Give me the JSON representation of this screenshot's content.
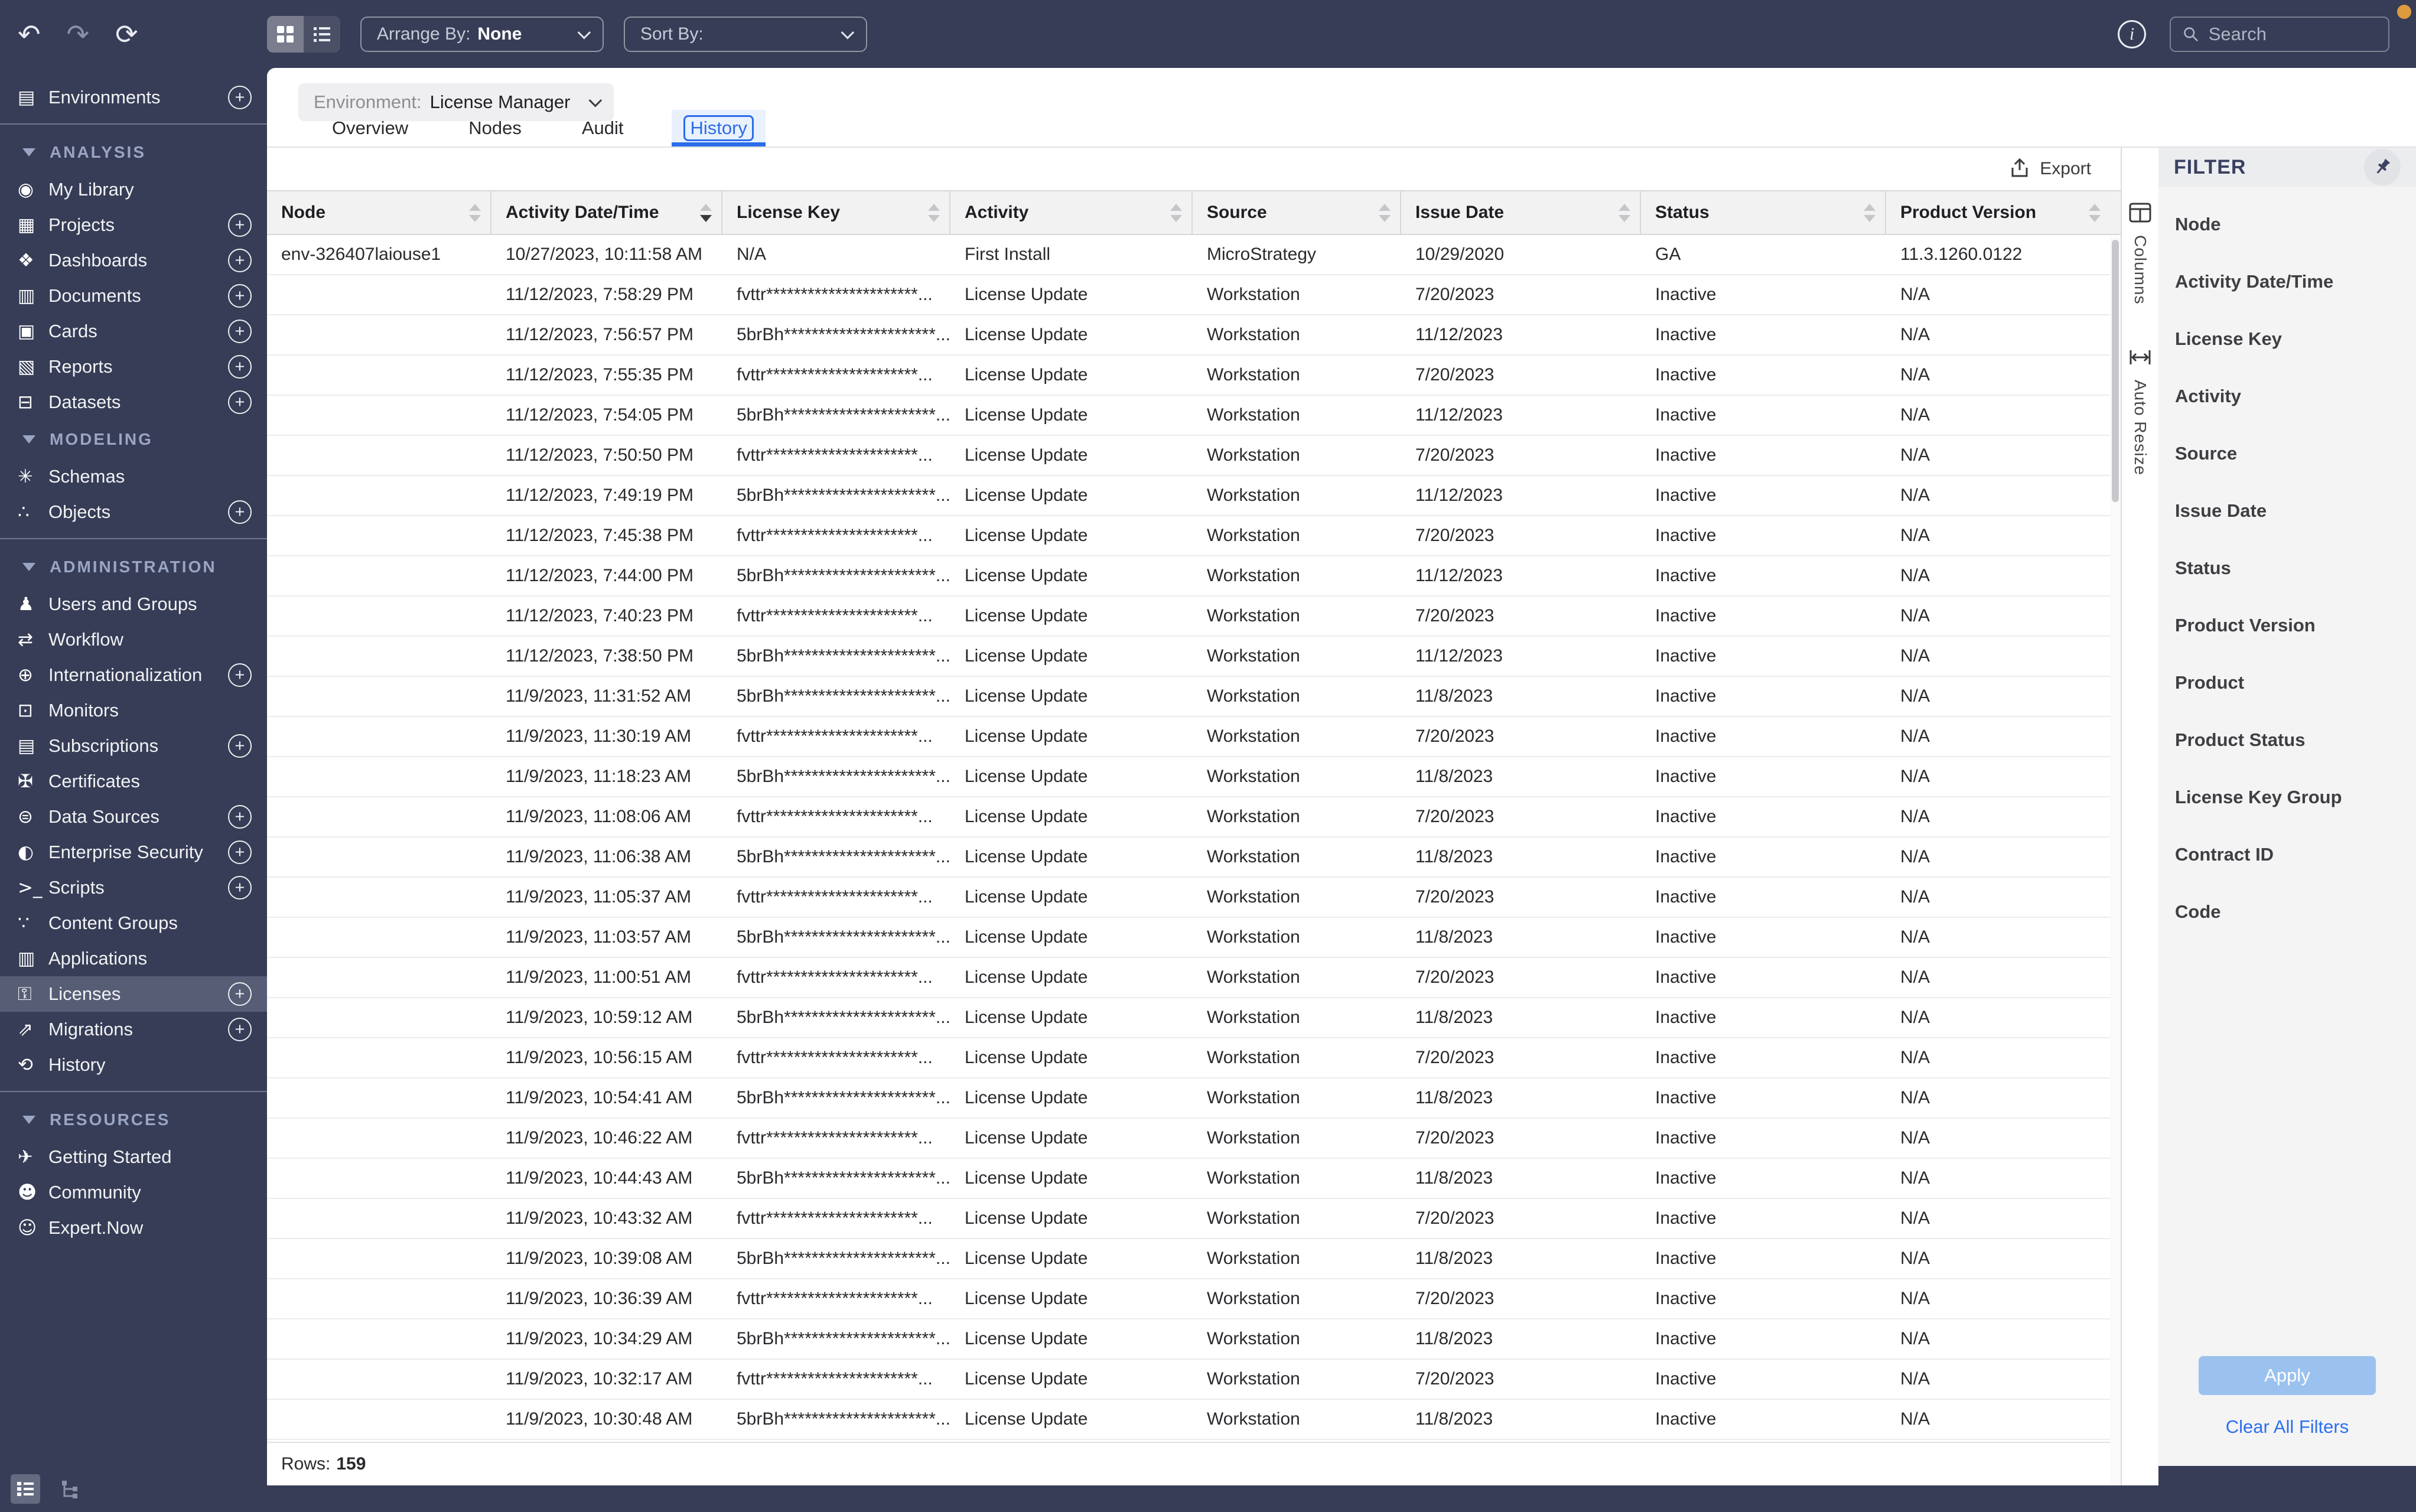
{
  "colors": {
    "topbar_navy": "#373D56",
    "accent_blue": "#2B6CEA",
    "apply_button": "#9BC2EE",
    "clear_link": "#2C6FEF",
    "notification_dot": "#DD9A3F",
    "sidebar_selected": "#575D75"
  },
  "topbar": {
    "arrange_by_label": "Arrange By:",
    "arrange_by_value": "None",
    "sort_by_label": "Sort By:",
    "search_placeholder": "Search"
  },
  "sidebar": {
    "items": [
      {
        "type": "item",
        "label": "Environments",
        "icon": "environments",
        "plus": true
      },
      {
        "type": "divider"
      },
      {
        "type": "section",
        "label": "ANALYSIS"
      },
      {
        "type": "item",
        "label": "My Library",
        "icon": "my-library"
      },
      {
        "type": "item",
        "label": "Projects",
        "icon": "projects",
        "plus": true
      },
      {
        "type": "item",
        "label": "Dashboards",
        "icon": "dashboards",
        "plus": true
      },
      {
        "type": "item",
        "label": "Documents",
        "icon": "documents",
        "plus": true
      },
      {
        "type": "item",
        "label": "Cards",
        "icon": "cards",
        "plus": true
      },
      {
        "type": "item",
        "label": "Reports",
        "icon": "reports",
        "plus": true
      },
      {
        "type": "item",
        "label": "Datasets",
        "icon": "datasets",
        "plus": true
      },
      {
        "type": "section",
        "label": "MODELING"
      },
      {
        "type": "item",
        "label": "Schemas",
        "icon": "schemas"
      },
      {
        "type": "item",
        "label": "Objects",
        "icon": "objects",
        "plus": true
      },
      {
        "type": "divider"
      },
      {
        "type": "section",
        "label": "ADMINISTRATION"
      },
      {
        "type": "item",
        "label": "Users and Groups",
        "icon": "users-and-groups"
      },
      {
        "type": "item",
        "label": "Workflow",
        "icon": "workflow"
      },
      {
        "type": "item",
        "label": "Internationalization",
        "icon": "internationalization",
        "plus": true
      },
      {
        "type": "item",
        "label": "Monitors",
        "icon": "monitors"
      },
      {
        "type": "item",
        "label": "Subscriptions",
        "icon": "subscriptions",
        "plus": true
      },
      {
        "type": "item",
        "label": "Certificates",
        "icon": "certificates"
      },
      {
        "type": "item",
        "label": "Data Sources",
        "icon": "data-sources",
        "plus": true
      },
      {
        "type": "item",
        "label": "Enterprise Security",
        "icon": "enterprise-security",
        "plus": true
      },
      {
        "type": "item",
        "label": "Scripts",
        "icon": "scripts",
        "plus": true
      },
      {
        "type": "item",
        "label": "Content Groups",
        "icon": "content-groups"
      },
      {
        "type": "item",
        "label": "Applications",
        "icon": "applications"
      },
      {
        "type": "item",
        "label": "Licenses",
        "icon": "licenses",
        "plus": true,
        "selected": true
      },
      {
        "type": "item",
        "label": "Migrations",
        "icon": "migrations",
        "plus": true
      },
      {
        "type": "item",
        "label": "History",
        "icon": "history"
      },
      {
        "type": "divider"
      },
      {
        "type": "section",
        "label": "RESOURCES"
      },
      {
        "type": "item",
        "label": "Getting Started",
        "icon": "getting-started"
      },
      {
        "type": "item",
        "label": "Community",
        "icon": "community"
      },
      {
        "type": "item",
        "label": "Expert.Now",
        "icon": "expert-now"
      }
    ]
  },
  "env": {
    "label": "Environment:",
    "value": "License Manager"
  },
  "tabs": [
    {
      "label": "Overview"
    },
    {
      "label": "Nodes"
    },
    {
      "label": "Audit"
    },
    {
      "label": "History",
      "active": true
    }
  ],
  "toolbar": {
    "export_label": "Export"
  },
  "table": {
    "columns": [
      {
        "label": "Node",
        "sort": "none"
      },
      {
        "label": "Activity Date/Time",
        "sort": "desc"
      },
      {
        "label": "License Key",
        "sort": "none"
      },
      {
        "label": "Activity",
        "sort": "none"
      },
      {
        "label": "Source",
        "sort": "none"
      },
      {
        "label": "Issue Date",
        "sort": "none"
      },
      {
        "label": "Status",
        "sort": "none"
      },
      {
        "label": "Product Version",
        "sort": "none"
      }
    ],
    "rows": [
      [
        "env-326407laiouse1",
        "10/27/2023, 10:11:58 AM",
        "N/A",
        "First Install",
        "MicroStrategy",
        "10/29/2020",
        "GA",
        "11.3.1260.0122"
      ],
      [
        "",
        "11/12/2023, 7:58:29 PM",
        "fvttr**********************...",
        "License Update",
        "Workstation",
        "7/20/2023",
        "Inactive",
        "N/A"
      ],
      [
        "",
        "11/12/2023, 7:56:57 PM",
        "5brBh**********************...",
        "License Update",
        "Workstation",
        "11/12/2023",
        "Inactive",
        "N/A"
      ],
      [
        "",
        "11/12/2023, 7:55:35 PM",
        "fvttr**********************...",
        "License Update",
        "Workstation",
        "7/20/2023",
        "Inactive",
        "N/A"
      ],
      [
        "",
        "11/12/2023, 7:54:05 PM",
        "5brBh**********************...",
        "License Update",
        "Workstation",
        "11/12/2023",
        "Inactive",
        "N/A"
      ],
      [
        "",
        "11/12/2023, 7:50:50 PM",
        "fvttr**********************...",
        "License Update",
        "Workstation",
        "7/20/2023",
        "Inactive",
        "N/A"
      ],
      [
        "",
        "11/12/2023, 7:49:19 PM",
        "5brBh**********************...",
        "License Update",
        "Workstation",
        "11/12/2023",
        "Inactive",
        "N/A"
      ],
      [
        "",
        "11/12/2023, 7:45:38 PM",
        "fvttr**********************...",
        "License Update",
        "Workstation",
        "7/20/2023",
        "Inactive",
        "N/A"
      ],
      [
        "",
        "11/12/2023, 7:44:00 PM",
        "5brBh**********************...",
        "License Update",
        "Workstation",
        "11/12/2023",
        "Inactive",
        "N/A"
      ],
      [
        "",
        "11/12/2023, 7:40:23 PM",
        "fvttr**********************...",
        "License Update",
        "Workstation",
        "7/20/2023",
        "Inactive",
        "N/A"
      ],
      [
        "",
        "11/12/2023, 7:38:50 PM",
        "5brBh**********************...",
        "License Update",
        "Workstation",
        "11/12/2023",
        "Inactive",
        "N/A"
      ],
      [
        "",
        "11/9/2023, 11:31:52 AM",
        "5brBh**********************...",
        "License Update",
        "Workstation",
        "11/8/2023",
        "Inactive",
        "N/A"
      ],
      [
        "",
        "11/9/2023, 11:30:19 AM",
        "fvttr**********************...",
        "License Update",
        "Workstation",
        "7/20/2023",
        "Inactive",
        "N/A"
      ],
      [
        "",
        "11/9/2023, 11:18:23 AM",
        "5brBh**********************...",
        "License Update",
        "Workstation",
        "11/8/2023",
        "Inactive",
        "N/A"
      ],
      [
        "",
        "11/9/2023, 11:08:06 AM",
        "fvttr**********************...",
        "License Update",
        "Workstation",
        "7/20/2023",
        "Inactive",
        "N/A"
      ],
      [
        "",
        "11/9/2023, 11:06:38 AM",
        "5brBh**********************...",
        "License Update",
        "Workstation",
        "11/8/2023",
        "Inactive",
        "N/A"
      ],
      [
        "",
        "11/9/2023, 11:05:37 AM",
        "fvttr**********************...",
        "License Update",
        "Workstation",
        "7/20/2023",
        "Inactive",
        "N/A"
      ],
      [
        "",
        "11/9/2023, 11:03:57 AM",
        "5brBh**********************...",
        "License Update",
        "Workstation",
        "11/8/2023",
        "Inactive",
        "N/A"
      ],
      [
        "",
        "11/9/2023, 11:00:51 AM",
        "fvttr**********************...",
        "License Update",
        "Workstation",
        "7/20/2023",
        "Inactive",
        "N/A"
      ],
      [
        "",
        "11/9/2023, 10:59:12 AM",
        "5brBh**********************...",
        "License Update",
        "Workstation",
        "11/8/2023",
        "Inactive",
        "N/A"
      ],
      [
        "",
        "11/9/2023, 10:56:15 AM",
        "fvttr**********************...",
        "License Update",
        "Workstation",
        "7/20/2023",
        "Inactive",
        "N/A"
      ],
      [
        "",
        "11/9/2023, 10:54:41 AM",
        "5brBh**********************...",
        "License Update",
        "Workstation",
        "11/8/2023",
        "Inactive",
        "N/A"
      ],
      [
        "",
        "11/9/2023, 10:46:22 AM",
        "fvttr**********************...",
        "License Update",
        "Workstation",
        "7/20/2023",
        "Inactive",
        "N/A"
      ],
      [
        "",
        "11/9/2023, 10:44:43 AM",
        "5brBh**********************...",
        "License Update",
        "Workstation",
        "11/8/2023",
        "Inactive",
        "N/A"
      ],
      [
        "",
        "11/9/2023, 10:43:32 AM",
        "fvttr**********************...",
        "License Update",
        "Workstation",
        "7/20/2023",
        "Inactive",
        "N/A"
      ],
      [
        "",
        "11/9/2023, 10:39:08 AM",
        "5brBh**********************...",
        "License Update",
        "Workstation",
        "11/8/2023",
        "Inactive",
        "N/A"
      ],
      [
        "",
        "11/9/2023, 10:36:39 AM",
        "fvttr**********************...",
        "License Update",
        "Workstation",
        "7/20/2023",
        "Inactive",
        "N/A"
      ],
      [
        "",
        "11/9/2023, 10:34:29 AM",
        "5brBh**********************...",
        "License Update",
        "Workstation",
        "11/8/2023",
        "Inactive",
        "N/A"
      ],
      [
        "",
        "11/9/2023, 10:32:17 AM",
        "fvttr**********************...",
        "License Update",
        "Workstation",
        "7/20/2023",
        "Inactive",
        "N/A"
      ],
      [
        "",
        "11/9/2023, 10:30:48 AM",
        "5brBh**********************...",
        "License Update",
        "Workstation",
        "11/8/2023",
        "Inactive",
        "N/A"
      ]
    ],
    "footer_label": "Rows:",
    "footer_value": "159"
  },
  "side_tools": {
    "columns_label": "Columns",
    "auto_resize_label": "Auto Resize"
  },
  "filter": {
    "title": "FILTER",
    "fields": [
      "Node",
      "Activity Date/Time",
      "License Key",
      "Activity",
      "Source",
      "Issue Date",
      "Status",
      "Product Version",
      "Product",
      "Product Status",
      "License Key Group",
      "Contract ID",
      "Code"
    ],
    "apply_label": "Apply",
    "clear_label": "Clear All Filters"
  }
}
